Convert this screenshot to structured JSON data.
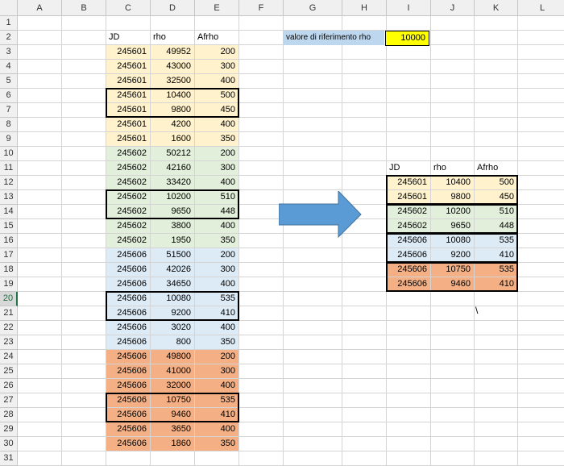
{
  "columns": [
    "A",
    "B",
    "C",
    "D",
    "E",
    "F",
    "G",
    "H",
    "I",
    "J",
    "K",
    "L"
  ],
  "rows": [
    "1",
    "2",
    "3",
    "4",
    "5",
    "6",
    "7",
    "8",
    "9",
    "10",
    "11",
    "12",
    "13",
    "14",
    "15",
    "16",
    "17",
    "18",
    "19",
    "20",
    "21",
    "22",
    "23",
    "24",
    "25",
    "26",
    "27",
    "28",
    "29",
    "30",
    "31"
  ],
  "selected_row": "20",
  "left_table": {
    "headers": [
      "JD",
      "rho",
      "Afrho"
    ],
    "rows": [
      {
        "jd": "245601",
        "rho": "49952",
        "afrho": "200",
        "color": "#fff2cc"
      },
      {
        "jd": "245601",
        "rho": "43000",
        "afrho": "300",
        "color": "#fff2cc"
      },
      {
        "jd": "245601",
        "rho": "32500",
        "afrho": "400",
        "color": "#fff2cc"
      },
      {
        "jd": "245601",
        "rho": "10400",
        "afrho": "500",
        "color": "#fff2cc"
      },
      {
        "jd": "245601",
        "rho": "9800",
        "afrho": "450",
        "color": "#fff2cc"
      },
      {
        "jd": "245601",
        "rho": "4200",
        "afrho": "400",
        "color": "#fff2cc"
      },
      {
        "jd": "245601",
        "rho": "1600",
        "afrho": "350",
        "color": "#fff2cc"
      },
      {
        "jd": "245602",
        "rho": "50212",
        "afrho": "200",
        "color": "#e2efda"
      },
      {
        "jd": "245602",
        "rho": "42160",
        "afrho": "300",
        "color": "#e2efda"
      },
      {
        "jd": "245602",
        "rho": "33420",
        "afrho": "400",
        "color": "#e2efda"
      },
      {
        "jd": "245602",
        "rho": "10200",
        "afrho": "510",
        "color": "#e2efda"
      },
      {
        "jd": "245602",
        "rho": "9650",
        "afrho": "448",
        "color": "#e2efda"
      },
      {
        "jd": "245602",
        "rho": "3800",
        "afrho": "400",
        "color": "#e2efda"
      },
      {
        "jd": "245602",
        "rho": "1950",
        "afrho": "350",
        "color": "#e2efda"
      },
      {
        "jd": "245606",
        "rho": "51500",
        "afrho": "200",
        "color": "#ddebf7"
      },
      {
        "jd": "245606",
        "rho": "42026",
        "afrho": "300",
        "color": "#ddebf7"
      },
      {
        "jd": "245606",
        "rho": "34650",
        "afrho": "400",
        "color": "#ddebf7"
      },
      {
        "jd": "245606",
        "rho": "10080",
        "afrho": "535",
        "color": "#ddebf7"
      },
      {
        "jd": "245606",
        "rho": "9200",
        "afrho": "410",
        "color": "#ddebf7"
      },
      {
        "jd": "245606",
        "rho": "3020",
        "afrho": "400",
        "color": "#ddebf7"
      },
      {
        "jd": "245606",
        "rho": "800",
        "afrho": "350",
        "color": "#ddebf7"
      },
      {
        "jd": "245606",
        "rho": "49800",
        "afrho": "200",
        "color": "#f4b084"
      },
      {
        "jd": "245606",
        "rho": "41000",
        "afrho": "300",
        "color": "#f4b084"
      },
      {
        "jd": "245606",
        "rho": "32000",
        "afrho": "400",
        "color": "#f4b084"
      },
      {
        "jd": "245606",
        "rho": "10750",
        "afrho": "535",
        "color": "#f4b084"
      },
      {
        "jd": "245606",
        "rho": "9460",
        "afrho": "410",
        "color": "#f4b084"
      },
      {
        "jd": "245606",
        "rho": "3650",
        "afrho": "400",
        "color": "#f4b084"
      },
      {
        "jd": "245606",
        "rho": "1860",
        "afrho": "350",
        "color": "#f4b084"
      }
    ]
  },
  "reference": {
    "caption": "valore di riferimento rho",
    "value": "10000"
  },
  "right_table": {
    "headers": [
      "JD",
      "rho",
      "Afrho"
    ],
    "rows": [
      {
        "jd": "245601",
        "rho": "10400",
        "afrho": "500",
        "color": "#fff2cc"
      },
      {
        "jd": "245601",
        "rho": "9800",
        "afrho": "450",
        "color": "#fff2cc"
      },
      {
        "jd": "245602",
        "rho": "10200",
        "afrho": "510",
        "color": "#e2efda"
      },
      {
        "jd": "245602",
        "rho": "9650",
        "afrho": "448",
        "color": "#e2efda"
      },
      {
        "jd": "245606",
        "rho": "10080",
        "afrho": "535",
        "color": "#ddebf7"
      },
      {
        "jd": "245606",
        "rho": "9200",
        "afrho": "410",
        "color": "#ddebf7"
      },
      {
        "jd": "245606",
        "rho": "10750",
        "afrho": "535",
        "color": "#f4b084"
      },
      {
        "jd": "245606",
        "rho": "9460",
        "afrho": "410",
        "color": "#f4b084"
      }
    ]
  },
  "arrow_color": "#5b9bd5",
  "stray_text": "\\"
}
